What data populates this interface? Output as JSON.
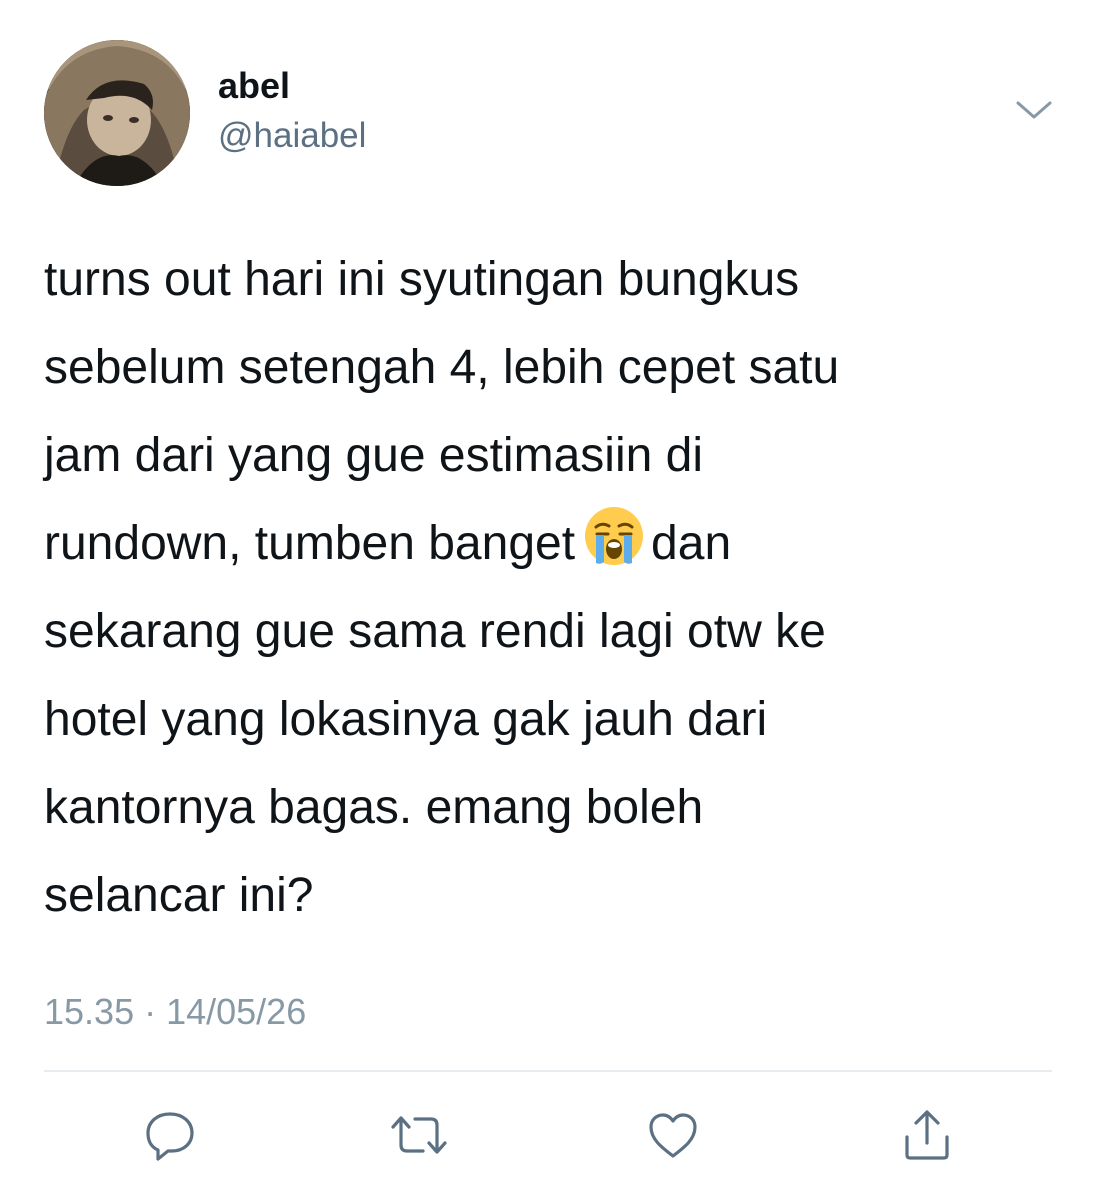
{
  "author": {
    "display_name": "abel",
    "handle": "@haiabel",
    "avatar_icon": "avatar-photo"
  },
  "more_icon": "chevron-down-icon",
  "tweet": {
    "lines": [
      "turns out hari ini syutingan bungkus",
      "sebelum setengah 4, lebih cepet satu",
      "jam dari yang gue estimasiin di",
      "rundown, tumben banget",
      "dan",
      "sekarang gue sama rendi lagi otw ke",
      "hotel yang lokasinya gak jauh dari",
      "kantornya bagas. emang boleh",
      "selancar ini?"
    ],
    "emoji": "loudly-crying-face"
  },
  "timestamp": "15.35 · 14/05/26",
  "actions": {
    "reply_icon": "reply-icon",
    "retweet_icon": "retweet-icon",
    "like_icon": "heart-icon",
    "share_icon": "share-icon"
  },
  "colors": {
    "text": "#0f1419",
    "secondary": "#5b7083",
    "timestamp": "#8899a6",
    "icon": "#5b7083",
    "divider": "#e6ecf0"
  }
}
